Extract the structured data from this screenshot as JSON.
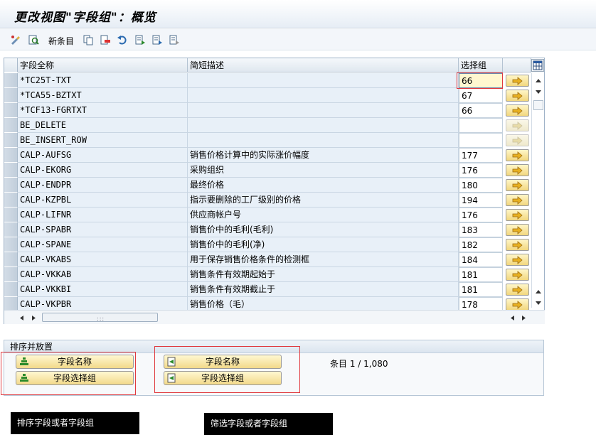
{
  "window": {
    "title": "更改视图\"字段组\"：概览"
  },
  "toolbar": {
    "new_entries_label": "新条目"
  },
  "table": {
    "headers": {
      "field_name": "字段全称",
      "short_desc": "简短描述",
      "select_group": "选择组"
    },
    "rows": [
      {
        "field": "*TC25T-TXT",
        "desc": "",
        "group": "66",
        "focused": true
      },
      {
        "field": "*TCA55-BZTXT",
        "desc": "",
        "group": "67"
      },
      {
        "field": "*TCF13-FGRTXT",
        "desc": "",
        "group": "66"
      },
      {
        "field": "BE_DELETE",
        "desc": "",
        "group": "",
        "disabled": true
      },
      {
        "field": "BE_INSERT_ROW",
        "desc": "",
        "group": "",
        "disabled": true
      },
      {
        "field": "CALP-AUFSG",
        "desc": "销售价格计算中的实际涨价幅度",
        "group": "177"
      },
      {
        "field": "CALP-EKORG",
        "desc": "采购组织",
        "group": "176"
      },
      {
        "field": "CALP-ENDPR",
        "desc": "最终价格",
        "group": "180"
      },
      {
        "field": "CALP-KZPBL",
        "desc": "指示要删除的工厂级别的价格",
        "group": "194"
      },
      {
        "field": "CALP-LIFNR",
        "desc": "供应商帐户号",
        "group": "176"
      },
      {
        "field": "CALP-SPABR",
        "desc": "销售价中的毛利(毛利)",
        "group": "183"
      },
      {
        "field": "CALP-SPANE",
        "desc": "销售价中的毛利(净)",
        "group": "182"
      },
      {
        "field": "CALP-VKABS",
        "desc": "用于保存销售价格条件的检测框",
        "group": "184"
      },
      {
        "field": "CALP-VKKAB",
        "desc": "销售条件有效期起始于",
        "group": "181"
      },
      {
        "field": "CALP-VKKBI",
        "desc": "销售条件有效期截止于",
        "group": "181"
      },
      {
        "field": "CALP-VKPBR",
        "desc": "销售价格（毛）",
        "group": "178"
      }
    ]
  },
  "sort_panel": {
    "title": "排序并放置",
    "sort_field_name": "字段名称",
    "sort_field_group": "字段选择组",
    "filter_field_name": "字段名称",
    "filter_field_group": "字段选择组",
    "entries": "条目 1 / 1,080"
  },
  "annotations": {
    "sort_callout": "排序字段或者字段组",
    "filter_callout": "筛选字段或者字段组"
  },
  "colors": {
    "highlight_red": "#e0393e",
    "button_yellow": "#f2d98a"
  }
}
